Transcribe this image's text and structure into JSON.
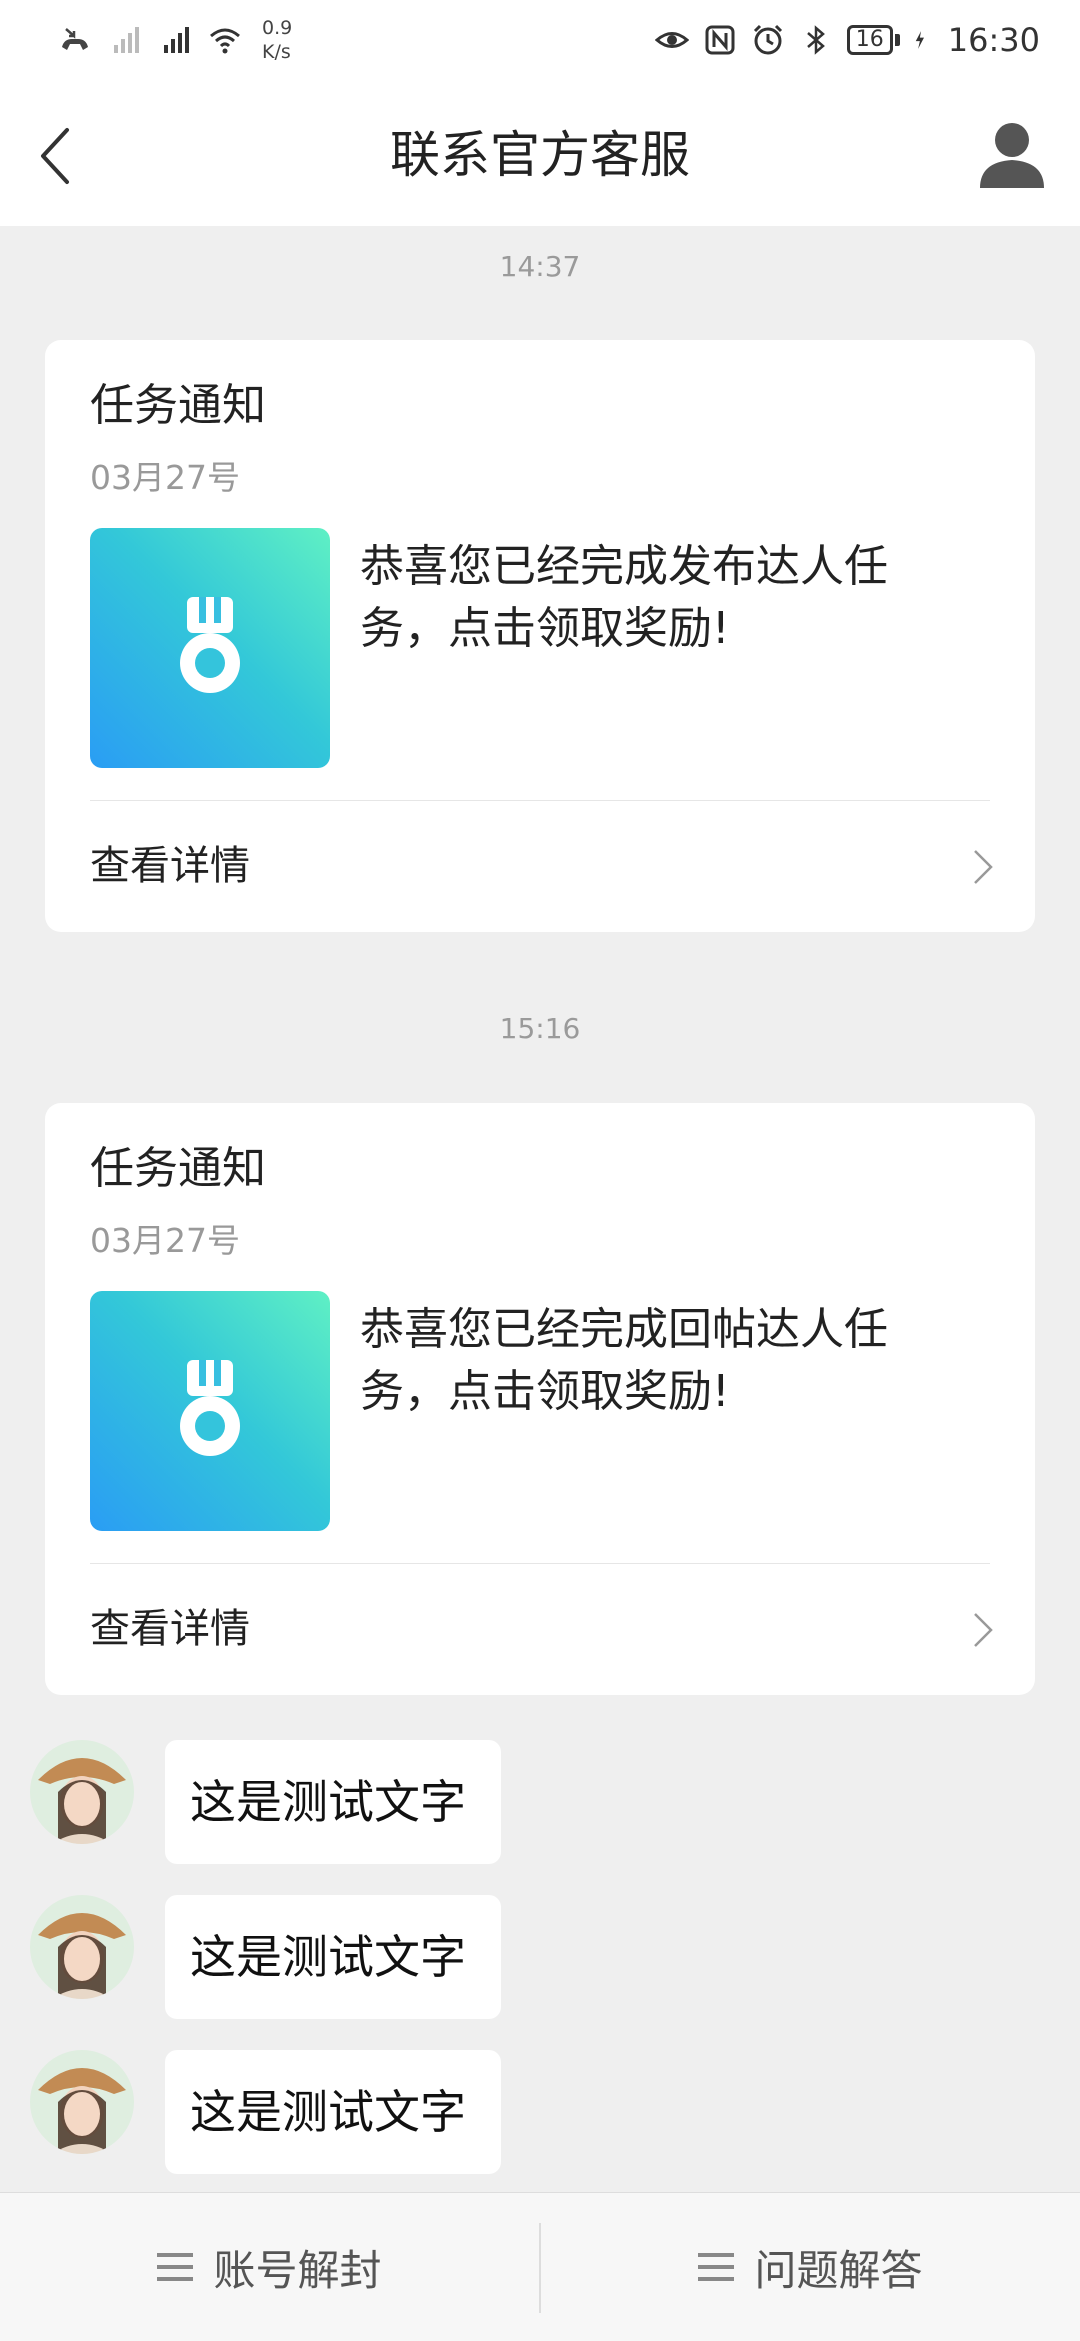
{
  "status_bar": {
    "net_speed_value": "0.9",
    "net_speed_unit": "K/s",
    "battery_level": "16",
    "time": "16:30",
    "icons": [
      "missed-call-icon",
      "hd-icon",
      "signal-off-icon",
      "5g-signal-icon",
      "wifi-icon",
      "eye-icon",
      "nfc-icon",
      "alarm-icon",
      "bluetooth-icon",
      "battery-icon",
      "charging-icon"
    ]
  },
  "nav": {
    "title": "联系官方客服",
    "back_icon": "chevron-left-icon",
    "profile_icon": "user-icon"
  },
  "messages": [
    {
      "time": "14:37",
      "card": {
        "title": "任务通知",
        "date": "03月27号",
        "text": "恭喜您已经完成发布达人任务，点击领取奖励!",
        "link_label": "查看详情",
        "image_icon": "medal-icon"
      }
    },
    {
      "time": "15:16",
      "card": {
        "title": "任务通知",
        "date": "03月27号",
        "text": "恭喜您已经完成回帖达人任务，点击领取奖励!",
        "link_label": "查看详情",
        "image_icon": "medal-icon"
      }
    }
  ],
  "chat": [
    {
      "text": "这是测试文字"
    },
    {
      "text": "这是测试文字"
    },
    {
      "text": "这是测试文字"
    }
  ],
  "bottom_bar": {
    "items": [
      {
        "label": "账号解封",
        "icon": "menu-icon"
      },
      {
        "label": "问题解答",
        "icon": "menu-icon"
      }
    ]
  },
  "colors": {
    "background": "#efefef",
    "card": "#ffffff",
    "medal_gradient_start": "#2a9df4",
    "medal_gradient_end": "#5ff0c4"
  }
}
